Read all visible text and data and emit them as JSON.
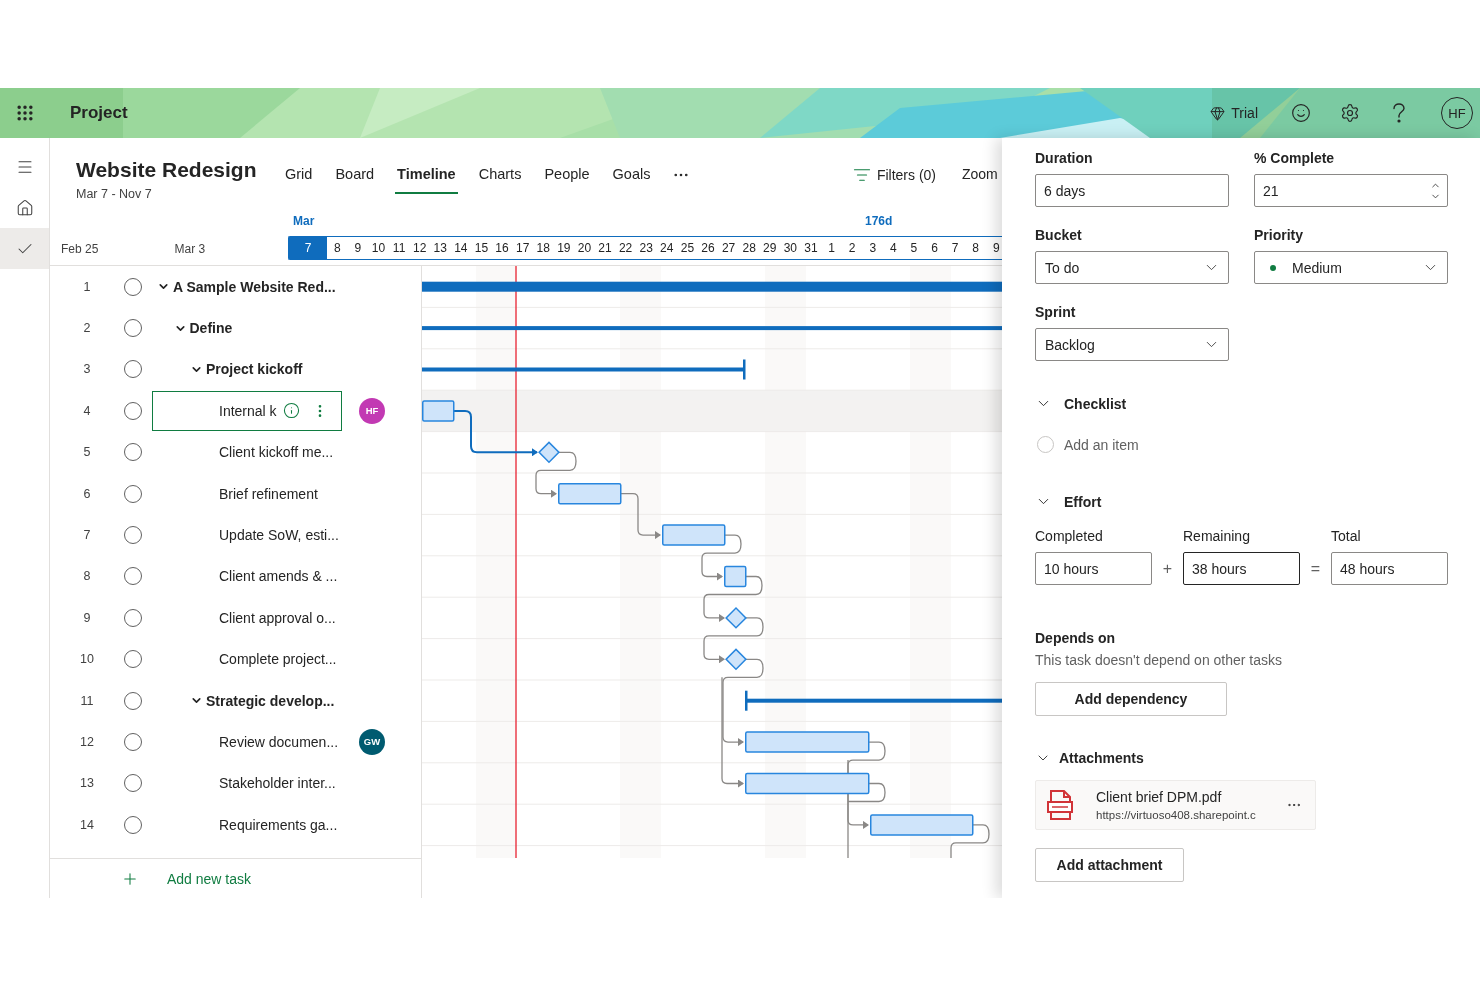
{
  "app": {
    "name": "Project"
  },
  "top_actions": {
    "trial": "Trial",
    "avatar": "HF"
  },
  "nav": [
    {
      "kind": "menu",
      "selected": false
    },
    {
      "kind": "home",
      "selected": false
    },
    {
      "kind": "tasks",
      "selected": true
    }
  ],
  "project": {
    "name": "Website Redesign",
    "dates": "Mar 7 - Nov 7"
  },
  "tabs": [
    {
      "label": "Grid",
      "selected": false
    },
    {
      "label": "Board",
      "selected": false
    },
    {
      "label": "Timeline",
      "selected": true
    },
    {
      "label": "Charts",
      "selected": false
    },
    {
      "label": "People",
      "selected": false
    },
    {
      "label": "Goals",
      "selected": false
    }
  ],
  "toolbar": {
    "filters": "Filters (0)",
    "zoom": "Zoom"
  },
  "timeline": {
    "range_labels": [
      "Feb 25",
      "Mar 3"
    ],
    "month": "Mar",
    "duration": "176d",
    "days": [
      {
        "label": "7",
        "selected": true
      },
      {
        "label": "8",
        "selected": false
      },
      {
        "label": "9",
        "selected": false
      },
      {
        "label": "10",
        "selected": false
      },
      {
        "label": "11",
        "selected": false
      },
      {
        "label": "12",
        "selected": false
      },
      {
        "label": "13",
        "selected": false
      },
      {
        "label": "14",
        "selected": false
      },
      {
        "label": "15",
        "selected": false
      },
      {
        "label": "16",
        "selected": false
      },
      {
        "label": "17",
        "selected": false
      },
      {
        "label": "18",
        "selected": false
      },
      {
        "label": "19",
        "selected": false
      },
      {
        "label": "20",
        "selected": false
      },
      {
        "label": "21",
        "selected": false
      },
      {
        "label": "22",
        "selected": false
      },
      {
        "label": "23",
        "selected": false
      },
      {
        "label": "24",
        "selected": false
      },
      {
        "label": "25",
        "selected": false
      },
      {
        "label": "26",
        "selected": false
      },
      {
        "label": "27",
        "selected": false
      },
      {
        "label": "28",
        "selected": false
      },
      {
        "label": "29",
        "selected": false
      },
      {
        "label": "30",
        "selected": false
      },
      {
        "label": "31",
        "selected": false
      },
      {
        "label": "1",
        "selected": false
      },
      {
        "label": "2",
        "selected": false
      },
      {
        "label": "3",
        "selected": false
      },
      {
        "label": "4",
        "selected": false
      },
      {
        "label": "5",
        "selected": false
      },
      {
        "label": "6",
        "selected": false
      },
      {
        "label": "7",
        "selected": false
      },
      {
        "label": "8",
        "selected": false
      },
      {
        "label": "9",
        "selected": false
      }
    ]
  },
  "tasks": [
    {
      "number": "1",
      "name": "A Sample Website Red...",
      "expanded": true,
      "checked": false,
      "selected": false,
      "children": [
        {
          "number": "2",
          "name": "Define",
          "expanded": true,
          "checked": false,
          "selected": false,
          "children": [
            {
              "number": "3",
              "name": "Project kickoff",
              "expanded": true,
              "checked": false,
              "selected": false,
              "children": [
                {
                  "number": "4",
                  "name": "Internal k",
                  "checked": false,
                  "selected": true,
                  "assignee": {
                    "initials": "HF",
                    "color": "#c239b3"
                  }
                },
                {
                  "number": "5",
                  "name": "Client kickoff me...",
                  "checked": false,
                  "selected": false
                },
                {
                  "number": "6",
                  "name": "Brief refinement",
                  "checked": false,
                  "selected": false
                },
                {
                  "number": "7",
                  "name": "Update SoW, esti...",
                  "checked": false,
                  "selected": false
                },
                {
                  "number": "8",
                  "name": "Client amends & ...",
                  "checked": false,
                  "selected": false
                },
                {
                  "number": "9",
                  "name": "Client approval o...",
                  "checked": false,
                  "selected": false
                },
                {
                  "number": "10",
                  "name": "Complete project...",
                  "checked": false,
                  "selected": false
                }
              ]
            },
            {
              "number": "11",
              "name": "Strategic develop...",
              "expanded": true,
              "checked": false,
              "selected": false,
              "children": [
                {
                  "number": "12",
                  "name": "Review documen...",
                  "checked": false,
                  "selected": false,
                  "assignee": {
                    "initials": "GW",
                    "color": "#005b70"
                  }
                },
                {
                  "number": "13",
                  "name": "Stakeholder inter...",
                  "checked": false,
                  "selected": false
                },
                {
                  "number": "14",
                  "name": "Requirements ga...",
                  "checked": false,
                  "selected": false
                }
              ]
            }
          ]
        }
      ]
    }
  ],
  "add_task": "Add new task",
  "details": {
    "duration": {
      "label": "Duration",
      "value": "6 days"
    },
    "percent_complete": {
      "label": "% Complete",
      "value": "21"
    },
    "bucket": {
      "label": "Bucket",
      "value": "To do"
    },
    "priority": {
      "label": "Priority",
      "value": "Medium"
    },
    "sprint": {
      "label": "Sprint",
      "value": "Backlog"
    },
    "checklist": {
      "title": "Checklist",
      "expanded": true,
      "checked": false,
      "placeholder": "Add an item"
    },
    "effort": {
      "title": "Effort",
      "expanded": true,
      "operators": [
        "+",
        "="
      ],
      "fields": [
        {
          "label": "Completed",
          "value": "10 hours",
          "focused": false
        },
        {
          "label": "Remaining",
          "value": "38 hours",
          "focused": true
        },
        {
          "label": "Total",
          "value": "48 hours",
          "focused": false
        }
      ]
    },
    "depends_on": {
      "title": "Depends on",
      "text": "This task doesn't depend on other tasks",
      "button": "Add dependency"
    },
    "attachments": {
      "title": "Attachments",
      "expanded": true,
      "button": "Add attachment",
      "files": [
        {
          "name": "Client brief DPM.pdf",
          "url": "https://virtuoso408.sharepoint.c"
        }
      ]
    }
  }
}
